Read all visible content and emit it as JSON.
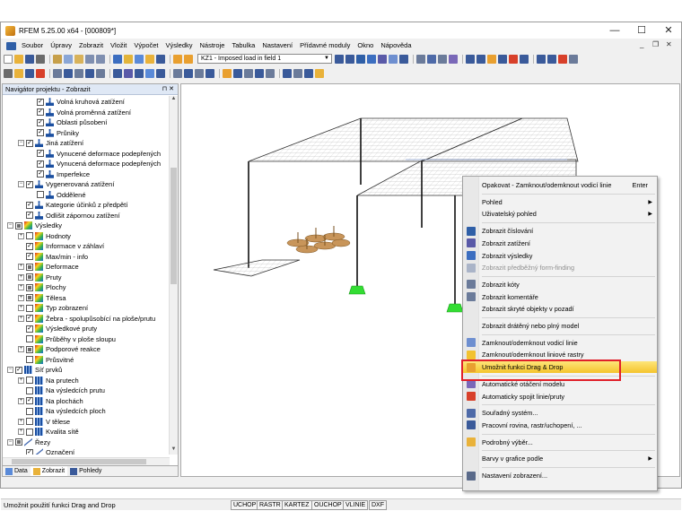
{
  "window": {
    "title": "RFEM 5.25.00 x64 - [000809*]",
    "minimize_glyph": "—",
    "maximize_glyph": "☐",
    "close_glyph": "✕"
  },
  "menu": {
    "items": [
      "Soubor",
      "Úpravy",
      "Zobrazit",
      "Vložit",
      "Výpočet",
      "Výsledky",
      "Nástroje",
      "Tabulka",
      "Nastavení",
      "Přídavné moduly",
      "Okno",
      "Nápověda"
    ],
    "doc_close_glyph": "✕",
    "doc_restore_glyph": "❐",
    "doc_min_glyph": "_"
  },
  "toolbar": {
    "load_case_combo": "KZ1 - Imposed load in field 1",
    "combo_arrow": "▼"
  },
  "navigator": {
    "title": "Navigátor projektu - Zobrazit",
    "pin_glyphs": "⊓ ✕",
    "tree": [
      {
        "label": "Volná kruhová zatížení",
        "level": 3,
        "exp": "",
        "check": "✓",
        "icon": "load"
      },
      {
        "label": "Volná proměnná zatížení",
        "level": 3,
        "exp": "",
        "check": "✓",
        "icon": "load"
      },
      {
        "label": "Oblasti působení",
        "level": 3,
        "exp": "",
        "check": "✓",
        "icon": "load"
      },
      {
        "label": "Průniky",
        "level": 3,
        "exp": "",
        "check": "✓",
        "icon": "load"
      },
      {
        "label": "Jiná zatížení",
        "level": 2,
        "exp": "−",
        "check": "✓",
        "icon": "load"
      },
      {
        "label": "Vynucené deformace podepřených",
        "level": 3,
        "exp": "",
        "check": "✓",
        "icon": "load"
      },
      {
        "label": "Vynucená deformace podepřených",
        "level": 3,
        "exp": "",
        "check": "✓",
        "icon": "load"
      },
      {
        "label": "Imperfekce",
        "level": 3,
        "exp": "",
        "check": "✓",
        "icon": "load"
      },
      {
        "label": "Vygenerovaná zatížení",
        "level": 2,
        "exp": "−",
        "check": "✓",
        "icon": "load"
      },
      {
        "label": "Oddělené",
        "level": 3,
        "exp": "",
        "check": " ",
        "icon": "load"
      },
      {
        "label": "Kategorie účinků z předpětí",
        "level": 2,
        "exp": "",
        "check": "✓",
        "icon": "load"
      },
      {
        "label": "Odlišit zápornou zatížení",
        "level": 2,
        "exp": "",
        "check": "✓",
        "icon": "load"
      },
      {
        "label": "Výsledky",
        "level": 1,
        "exp": "−",
        "check": "■",
        "icon": "res"
      },
      {
        "label": "Hodnoty",
        "level": 2,
        "exp": "+",
        "check": " ",
        "icon": "res"
      },
      {
        "label": "Informace v záhlaví",
        "level": 2,
        "exp": "",
        "check": "✓",
        "icon": "res"
      },
      {
        "label": "Max/min - info",
        "level": 2,
        "exp": "",
        "check": "✓",
        "icon": "res"
      },
      {
        "label": "Deformace",
        "level": 2,
        "exp": "+",
        "check": "■",
        "icon": "res"
      },
      {
        "label": "Pruty",
        "level": 2,
        "exp": "+",
        "check": "■",
        "icon": "res"
      },
      {
        "label": "Plochy",
        "level": 2,
        "exp": "+",
        "check": "■",
        "icon": "res"
      },
      {
        "label": "Tělesa",
        "level": 2,
        "exp": "+",
        "check": "■",
        "icon": "res"
      },
      {
        "label": "Typ zobrazení",
        "level": 2,
        "exp": "+",
        "check": " ",
        "icon": "res"
      },
      {
        "label": "Žebra - spolupůsobící na ploše/prutu",
        "level": 2,
        "exp": "+",
        "check": "✓",
        "icon": "res"
      },
      {
        "label": "Výsledkové pruty",
        "level": 2,
        "exp": "",
        "check": "✓",
        "icon": "res"
      },
      {
        "label": "Průběhy v ploše sloupu",
        "level": 2,
        "exp": "",
        "check": " ",
        "icon": "res"
      },
      {
        "label": "Podporové reakce",
        "level": 2,
        "exp": "+",
        "check": "■",
        "icon": "res"
      },
      {
        "label": "Průsvitné",
        "level": 2,
        "exp": "",
        "check": " ",
        "icon": "res"
      },
      {
        "label": "Síť prvků",
        "level": 1,
        "exp": "−",
        "check": "✓",
        "icon": "mesh"
      },
      {
        "label": "Na prutech",
        "level": 2,
        "exp": "+",
        "check": " ",
        "icon": "mesh"
      },
      {
        "label": "Na výsledcích prutu",
        "level": 2,
        "exp": "",
        "check": " ",
        "icon": "mesh"
      },
      {
        "label": "Na plochách",
        "level": 2,
        "exp": "+",
        "check": "✓",
        "icon": "mesh"
      },
      {
        "label": "Na výsledcích ploch",
        "level": 2,
        "exp": "",
        "check": " ",
        "icon": "mesh"
      },
      {
        "label": "V tělese",
        "level": 2,
        "exp": "+",
        "check": " ",
        "icon": "mesh"
      },
      {
        "label": "Kvalita sítě",
        "level": 2,
        "exp": "+",
        "check": " ",
        "icon": "mesh"
      },
      {
        "label": "Řezy",
        "level": 1,
        "exp": "−",
        "check": "■",
        "icon": "bar"
      },
      {
        "label": "Označení",
        "level": 2,
        "exp": "",
        "check": "✓",
        "icon": "bar"
      }
    ],
    "tabs": [
      {
        "label": "Data"
      },
      {
        "label": "Zobrazit"
      },
      {
        "label": "Pohledy"
      }
    ]
  },
  "context_menu": {
    "items": [
      {
        "label": "Opakovat - Zamknout/odemknout vodicí linie",
        "shortcut": "Enter",
        "icon": ""
      },
      {
        "sep": true
      },
      {
        "label": "Pohled",
        "submenu": true,
        "icon": ""
      },
      {
        "label": "Uživatelský pohled",
        "submenu": true,
        "icon": ""
      },
      {
        "sep": true
      },
      {
        "label": "Zobrazit číslování",
        "icon": "#2f5fa7"
      },
      {
        "label": "Zobrazit zatížení",
        "icon": "#5a5aa8"
      },
      {
        "label": "Zobrazit výsledky",
        "icon": "#3c6ec0"
      },
      {
        "label": "Zobrazit předběžný form-finding",
        "disabled": true,
        "icon": "#aab4c8"
      },
      {
        "sep": true
      },
      {
        "label": "Zobrazit kóty",
        "icon": "#6b7b9a"
      },
      {
        "label": "Zobrazit komentáře",
        "icon": "#6b7b9a"
      },
      {
        "label": "Zobrazit skryté objekty v pozadí",
        "icon": ""
      },
      {
        "sep": true
      },
      {
        "label": "Zobrazit drátěný nebo plný model",
        "icon": ""
      },
      {
        "sep": true
      },
      {
        "label": "Zamknout/odemknout vodicí linie",
        "icon": "#6e8fd0"
      },
      {
        "label": "Zamknout/odemknout liniové rastry",
        "icon": "#f2c230"
      },
      {
        "label": "Umožnit funkci Drag & Drop",
        "highlight": true,
        "icon": "#e8a030"
      },
      {
        "sep": true
      },
      {
        "label": "Automatické otáčení modelu",
        "icon": "#7a68b8"
      },
      {
        "label": "Automaticky spojit linie/pruty",
        "icon": "#d8402a"
      },
      {
        "sep": true
      },
      {
        "label": "Souřadný systém...",
        "icon": "#4e6aa8"
      },
      {
        "label": "Pracovní rovina, rastr/uchopení, ...",
        "icon": "#3a5a9a"
      },
      {
        "sep": true
      },
      {
        "label": "Podrobný výběr...",
        "icon": "#e9b23a"
      },
      {
        "sep": true
      },
      {
        "label": "Barvy v grafice podle",
        "submenu": true,
        "icon": ""
      },
      {
        "sep": true
      },
      {
        "label": "Nastavení zobrazení...",
        "icon": "#5a6a8a"
      }
    ],
    "submenu_glyph": "▶"
  },
  "statusbar": {
    "text": "Umožnit použití funkci Drag and Drop",
    "toggles": [
      "UCHOP",
      "RASTR",
      "KARTEZ",
      "OUCHOP",
      "VLINIE",
      "DXF"
    ]
  },
  "colors": {
    "highlight": "#f5c42c",
    "redbox": "#e0202a",
    "support": "#33dd33",
    "load_discs": "#c8955a"
  }
}
